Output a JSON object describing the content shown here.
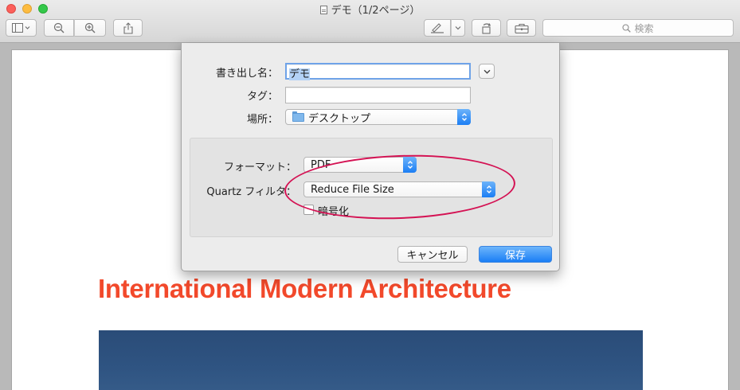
{
  "window": {
    "title": "デモ（1/2ページ）",
    "search_placeholder": "検索"
  },
  "icons": {
    "sidebar": "sidebar-toggle-icon",
    "zoom_out": "zoom-out-icon",
    "zoom_in": "zoom-in-icon",
    "share": "share-icon",
    "markup": "pen-icon",
    "rotate": "rotate-icon",
    "toolbox": "toolbox-icon",
    "search": "search-icon"
  },
  "dialog": {
    "name_label": "書き出し名：",
    "name_value": "デモ",
    "tags_label": "タグ：",
    "tags_value": "",
    "where_label": "場所：",
    "where_value": "デスクトップ",
    "format_label": "フォーマット：",
    "format_value": "PDF",
    "filter_label": "Quartz フィルタ：",
    "filter_value": "Reduce File Size",
    "encrypt_label": "暗号化",
    "encrypt_checked": false,
    "cancel_label": "キャンセル",
    "save_label": "保存"
  },
  "document": {
    "heading": "International Modern Architecture"
  },
  "colors": {
    "accent_blue": "#1a7ef5",
    "heading_red": "#f2492b",
    "annotation": "#d41253"
  }
}
